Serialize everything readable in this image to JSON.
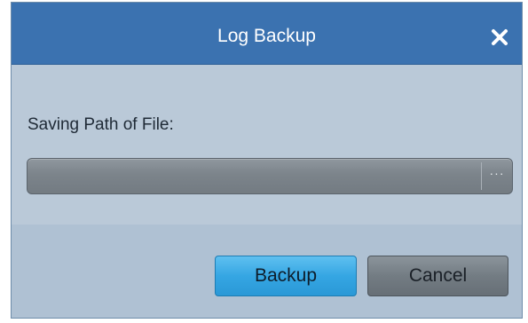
{
  "dialog": {
    "title": "Log Backup",
    "close_icon": "close-icon",
    "close_glyph": "✖"
  },
  "form": {
    "path_label": "Saving Path of File:",
    "path_value": "",
    "browse_label": "···"
  },
  "buttons": {
    "backup_label": "Backup",
    "cancel_label": "Cancel"
  },
  "colors": {
    "titlebar": "#3b72b0",
    "body": "#bac9d8",
    "primary_button": "#35a6e3",
    "secondary_button": "#737c83"
  }
}
